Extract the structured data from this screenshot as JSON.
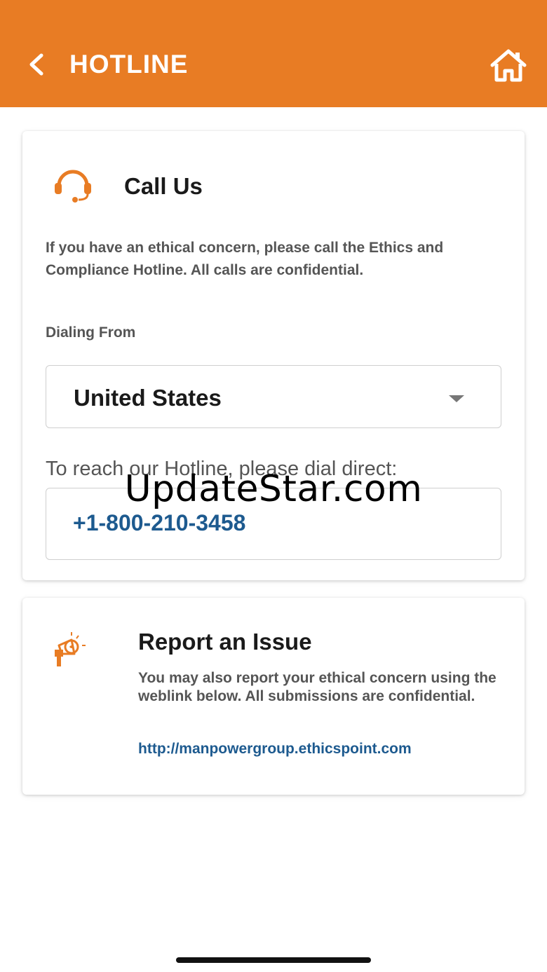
{
  "app_bar": {
    "title": "HOTLINE",
    "back_icon": "chevron-left-icon",
    "home_icon": "home-icon",
    "background_color": "#e87c24"
  },
  "call_card": {
    "icon": "headset-icon",
    "title": "Call Us",
    "description": "If you have an ethical concern, please call the Ethics and Compliance Hotline. All calls are confidential.",
    "dialing_from_label": "Dialing From",
    "country_select": {
      "value": "United States",
      "icon": "chevron-down-icon"
    },
    "reach_label": "To reach our Hotline, please dial direct:",
    "phone_number": "+1-800-210-3458"
  },
  "report_card": {
    "icon": "megaphone-icon",
    "title": "Report an Issue",
    "description": "You may also report your ethical concern using the weblink below. All submissions are confidential.",
    "link": "http://manpowergroup.ethicspoint.com"
  },
  "watermark": "UpdateStar.com",
  "colors": {
    "accent": "#e87c24",
    "link": "#1d5a8f",
    "text_muted": "#555555"
  }
}
